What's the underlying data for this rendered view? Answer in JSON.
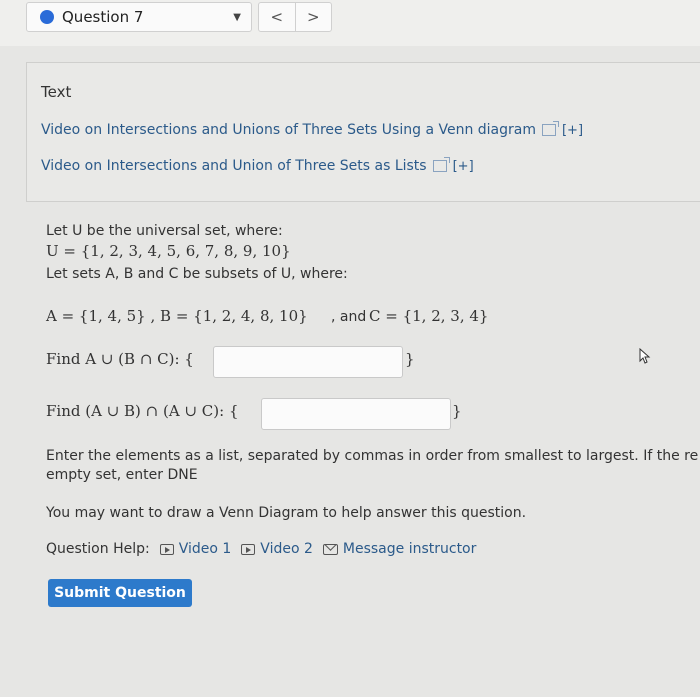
{
  "header": {
    "question_label": "Question 7",
    "prev_symbol": "<",
    "next_symbol": ">"
  },
  "resources": {
    "title": "Text",
    "links": [
      {
        "label": "Video on Intersections and Unions of Three Sets Using a Venn diagram",
        "expand": "[+]"
      },
      {
        "label": "Video on Intersections and Union of Three Sets as Lists",
        "expand": "[+]"
      }
    ]
  },
  "problem": {
    "line1": "Let U be the universal set, where:",
    "universal_set": "U = {1, 2, 3, 4, 5, 6, 7, 8, 9, 10}",
    "line3": "Let sets A, B and C be subsets of U, where:",
    "sets_a_b": "A = {1, 4, 5} , B = {1, 2, 4, 8, 10}",
    "sets_and": ", and",
    "sets_c": "C = {1, 2, 3, 4}",
    "find1_label": "Find A ∪ (B ∩ C): {",
    "find1_close": "}",
    "find1_value": "",
    "find2_label": "Find (A ∪ B) ∩ (A ∪ C): {",
    "find2_close": "}",
    "find2_value": "",
    "instruction_line1": "Enter the elements as a list, separated by commas in order from smallest to largest. If the re",
    "instruction_line2": "empty set, enter DNE",
    "hint": "You may want to draw a Venn Diagram to help answer this question."
  },
  "help": {
    "label": "Question Help:",
    "video1": "Video 1",
    "video2": "Video 2",
    "message": "Message instructor"
  },
  "submit_label": "Submit Question",
  "colors": {
    "accent": "#2d7acb",
    "link": "#2b5a8a",
    "status_dot": "#2a6bd8"
  }
}
